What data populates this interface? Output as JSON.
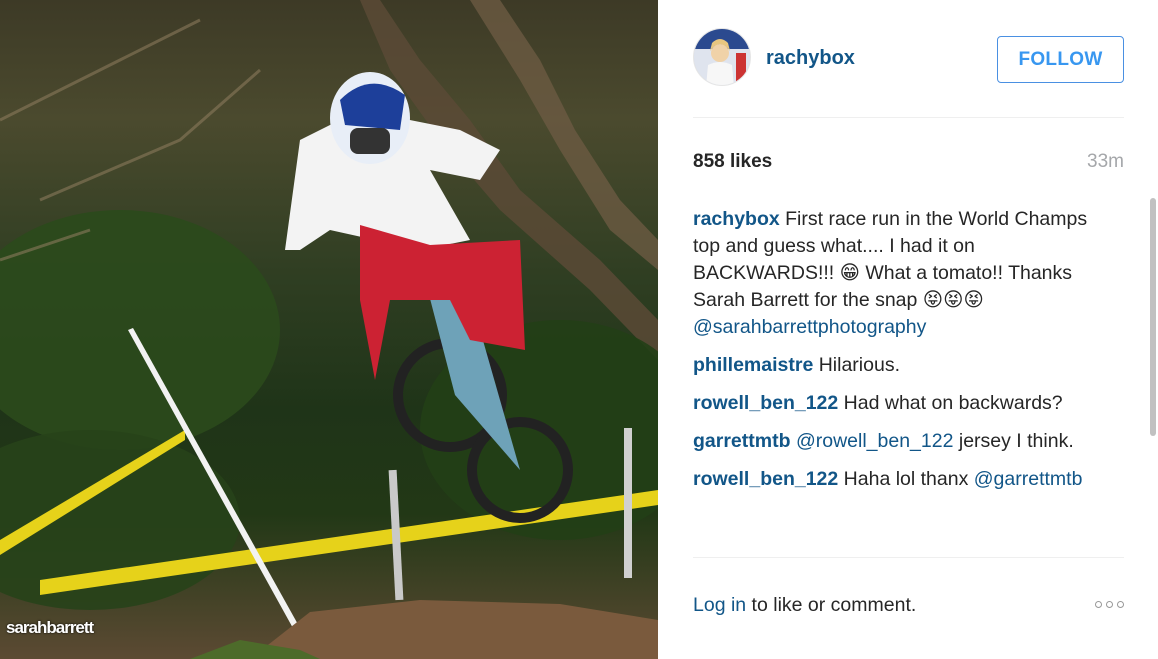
{
  "post": {
    "image_alt": "Downhill mountain bike rider jumping",
    "watermark": "sarahbarrett"
  },
  "header": {
    "username": "rachybox",
    "follow_label": "FOLLOW"
  },
  "stats": {
    "likes": "858 likes",
    "time": "33m"
  },
  "caption": {
    "user": "rachybox",
    "text": "First race run in the World Champs top and guess what.... I had it on BACKWARDS!!! 😁 What a tomato!! Thanks Sarah Barrett for the snap 😝😝😝",
    "mention": "@sarahbarrettphotography"
  },
  "comments": [
    {
      "user": "phillemaistre",
      "text": "Hilarious.",
      "mention": ""
    },
    {
      "user": "rowell_ben_122",
      "text": "Had what on backwards?",
      "mention": ""
    },
    {
      "user": "garrettmtb",
      "text": "jersey I think.",
      "mention": "@rowell_ben_122"
    },
    {
      "user": "rowell_ben_122",
      "text": "Haha lol thanx",
      "mention": "@garrettmtb"
    }
  ],
  "footer": {
    "login_label": "Log in",
    "rest_label": " to like or comment."
  },
  "colors": {
    "link": "#125688",
    "follow": "#3897f0",
    "muted": "#a5a7aa"
  },
  "icons": {
    "more": "more-options-icon"
  }
}
